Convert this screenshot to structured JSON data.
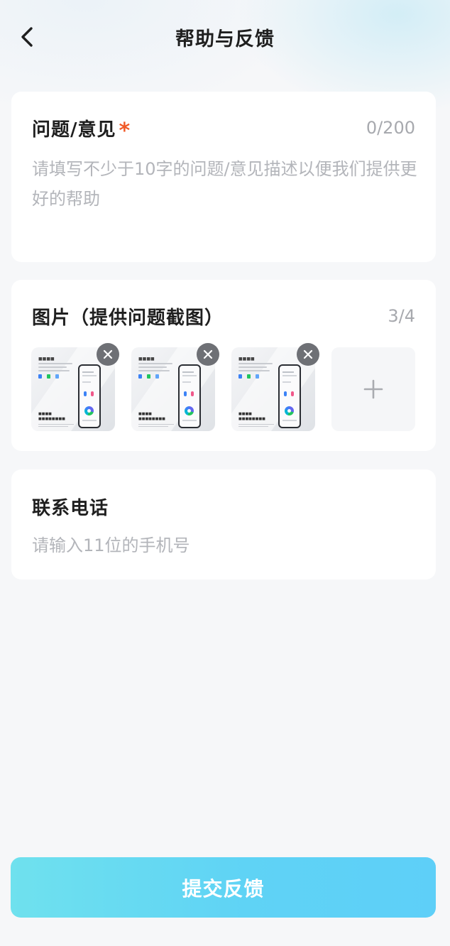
{
  "header": {
    "title": "帮助与反馈",
    "back_icon": "chevron-left-icon"
  },
  "opinion": {
    "title": "问题/意见",
    "required_mark": "*",
    "counter": "0/200",
    "placeholder": "请填写不少于10字的问题/意见描述以便我们提供更好的帮助",
    "value": ""
  },
  "images": {
    "title": "图片（提供问题截图）",
    "counter": "3/4",
    "items": [
      {
        "remove_icon": "close-icon"
      },
      {
        "remove_icon": "close-icon"
      },
      {
        "remove_icon": "close-icon"
      }
    ],
    "add_icon": "plus-icon"
  },
  "phone": {
    "title": "联系电话",
    "placeholder": "请输入11位的手机号",
    "value": ""
  },
  "submit": {
    "label": "提交反馈"
  },
  "colors": {
    "required_star": "#f05a28",
    "submit_gradient_start": "#6fe1ee",
    "submit_gradient_end": "#5ecff8",
    "remove_badge": "#6e7075"
  }
}
